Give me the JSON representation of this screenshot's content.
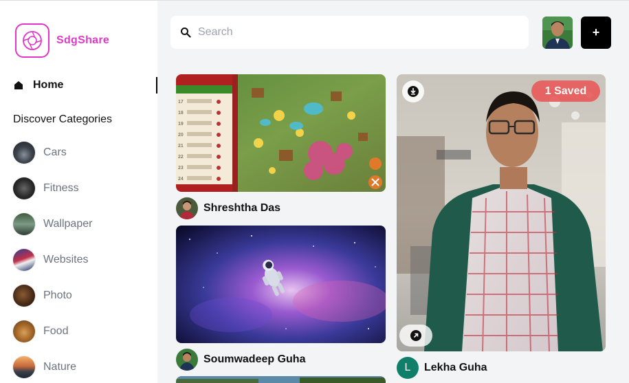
{
  "app": {
    "name": "SdgShare"
  },
  "sidebar": {
    "home_label": "Home",
    "discover_title": "Discover Categories",
    "categories": [
      {
        "label": "Cars"
      },
      {
        "label": "Fitness"
      },
      {
        "label": "Wallpaper"
      },
      {
        "label": "Websites"
      },
      {
        "label": "Photo"
      },
      {
        "label": "Food"
      },
      {
        "label": "Nature"
      }
    ]
  },
  "header": {
    "search_placeholder": "Search",
    "add_label": "+"
  },
  "feed": {
    "pins": [
      {
        "author": "Shreshtha Das"
      },
      {
        "author": "Soumwadeep Guha"
      },
      {
        "author": "Lekha Guha",
        "author_initial": "L",
        "saved_label": "1 Saved"
      }
    ]
  },
  "colors": {
    "brand": "#e234c8",
    "saved": "#e85a5a",
    "page_bg": "#f3f4f6"
  }
}
